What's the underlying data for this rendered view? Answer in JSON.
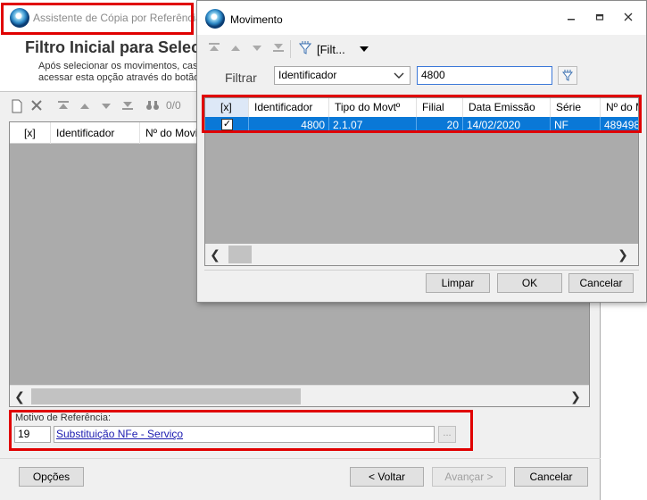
{
  "main": {
    "title": "Assistente de Cópia por Referência",
    "header_title": "Filtro Inicial para Selec",
    "header_desc_line1": "Após selecionar os movimentos, caso",
    "header_desc_line2": "acessar esta opção através do botão",
    "toolbar_counter": "0/0",
    "grid_columns": [
      "[x]",
      "Identificador",
      "Nº do Movin"
    ],
    "motivo_label": "Motivo de Referência:",
    "motivo_code": "19",
    "motivo_desc": "Substituição NFe - Serviço",
    "motivo_btn": "...",
    "buttons": {
      "options": "Opções",
      "back": "< Voltar",
      "next": "Avançar >",
      "cancel": "Cancelar"
    }
  },
  "dialog": {
    "title": "Movimento",
    "toolbar_filter_label": "[Filt...",
    "filter_label": "Filtrar",
    "filter_select": "Identificador",
    "filter_value": "4800",
    "columns": [
      "[x]",
      "Identificador",
      "Tipo do Movtº",
      "Filial",
      "Data Emissão",
      "Série",
      "Nº do M"
    ],
    "rows": [
      {
        "checked": "✓",
        "identificador": "4800",
        "tipo": "2.1.07",
        "filial": "20",
        "data": "14/02/2020",
        "serie": "NF",
        "numero": "489498"
      }
    ],
    "buttons": {
      "clear": "Limpar",
      "ok": "OK",
      "cancel": "Cancelar"
    }
  },
  "colors": {
    "highlight": "#e00000",
    "selection": "#0a78d7",
    "grid_bg": "#ababab"
  }
}
